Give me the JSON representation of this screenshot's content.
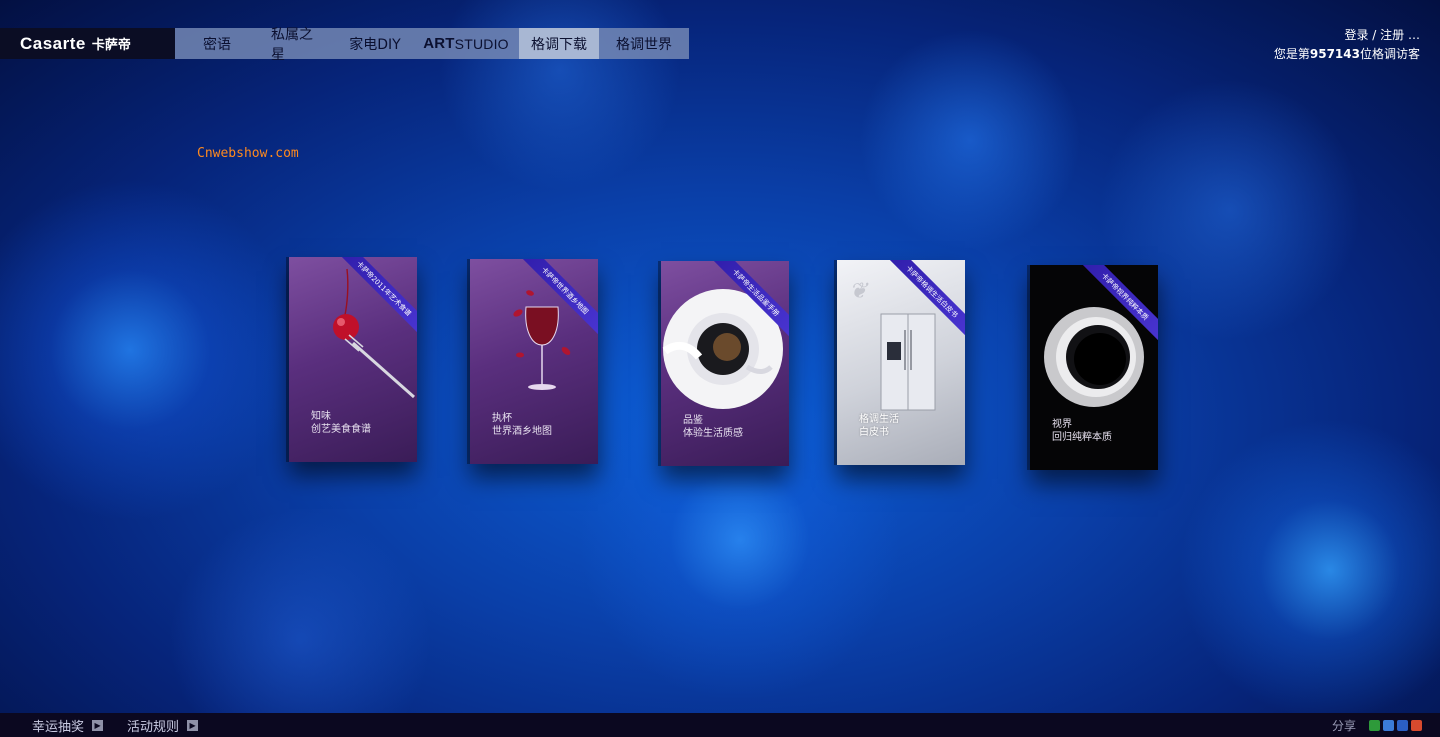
{
  "header": {
    "brand": "Casarte",
    "brand_cn": "卡萨帝",
    "nav": [
      {
        "label": "密语"
      },
      {
        "label": "私属之星"
      },
      {
        "label": "家电DIY"
      },
      {
        "label_strong": "ART",
        "label_rest": "STUDIO"
      },
      {
        "label": "格调下载",
        "active": true
      },
      {
        "label": "格调世界"
      }
    ],
    "login": "登录",
    "separator": "/",
    "register": "注册",
    "more": "…",
    "visitor_prefix": "您是第",
    "visitor_count": "957143",
    "visitor_suffix": "位格调访客"
  },
  "watermark": "Cnwebshow.com",
  "books": [
    {
      "ribbon": "卡萨帝2011年艺术食谱",
      "caption_title": "知味",
      "caption_sub": "创艺美食食谱",
      "theme": "purple",
      "icon": "cherry-fork-icon"
    },
    {
      "ribbon": "卡萨帝世界酒乡地图",
      "caption_title": "执杯",
      "caption_sub": "世界酒乡地图",
      "theme": "purple",
      "icon": "wine-glass-icon"
    },
    {
      "ribbon": "卡萨帝生活品鉴手册",
      "caption_title": "品鉴",
      "caption_sub": "体验生活质感",
      "theme": "purple",
      "icon": "coffee-cup-icon"
    },
    {
      "ribbon": "卡萨帝格调生活白皮书",
      "caption_title": "格调生活",
      "caption_sub": "白皮书",
      "theme": "silver",
      "icon": "refrigerator-icon"
    },
    {
      "ribbon": "卡萨帝视界纯粹本质",
      "caption_title": "视界",
      "caption_sub": "回归纯粹本质",
      "theme": "black",
      "icon": "bowl-icon"
    }
  ],
  "footer": {
    "lucky_draw": "幸运抽奖",
    "rules": "活动规则",
    "share_label": "分享",
    "share_icons": [
      {
        "name": "douban-share-icon",
        "color": "#2e9a3a"
      },
      {
        "name": "sina-share-icon",
        "color": "#3b7bd8"
      },
      {
        "name": "renren-share-icon",
        "color": "#2b5fc4"
      },
      {
        "name": "kaixin-share-icon",
        "color": "#d84a2e"
      }
    ]
  }
}
